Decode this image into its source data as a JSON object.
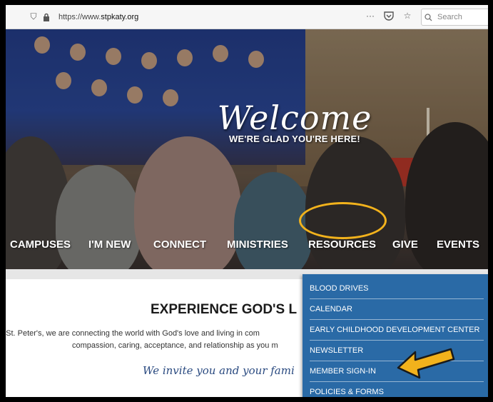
{
  "browser": {
    "url_prefix": "https://www.",
    "url_domain": "stpkaty.org",
    "search_placeholder": "Search",
    "more_glyph": "···",
    "shield_glyph": "⛉",
    "lock_glyph": "🔒",
    "pocket_glyph": "◡",
    "star_glyph": "☆",
    "search_glyph": "⌕"
  },
  "hero": {
    "welcome": "Welcome",
    "subtitle": "WE'RE GLAD YOU'RE HERE!"
  },
  "nav": {
    "items": [
      "CAMPUSES",
      "I'M NEW",
      "CONNECT",
      "MINISTRIES",
      "RESOURCES",
      "GIVE",
      "EVENTS"
    ]
  },
  "content": {
    "headline": "EXPERIENCE GOD'S L",
    "body_line_1": "t St. Peter's, we are connecting the world with God's love and living in com",
    "body_line_2": "compassion, caring, acceptance, and relationship as you m",
    "invite": "We invite you and your fami"
  },
  "dropdown": {
    "items": [
      "BLOOD DRIVES",
      "CALENDAR",
      "EARLY CHILDHOOD DEVELOPMENT CENTER",
      "NEWSLETTER",
      "MEMBER SIGN-IN",
      "POLICIES & FORMS"
    ]
  },
  "colors": {
    "highlight": "#f2b21c",
    "dropdown_bg": "#2a6aa6",
    "arrow": "#f2b21c"
  }
}
